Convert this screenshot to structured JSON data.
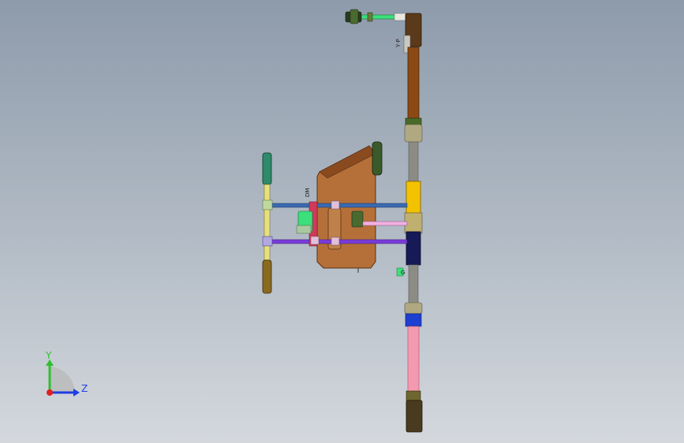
{
  "viewport": {
    "background_top": "#8e9bab",
    "background_bottom": "#d4d8dd"
  },
  "triad": {
    "y_label": "Y",
    "z_label": "Z",
    "y_color": "#2fbf2f",
    "z_color": "#1f3fe0",
    "x_color": "#e02020"
  },
  "part_labels": {
    "top_elbow": "Y·P",
    "small_tag": "DM",
    "valve_tag": "G"
  },
  "colors": {
    "brown_pipe": "#8b4a14",
    "brown_dark": "#5a3a1a",
    "gold": "#f2c200",
    "navy": "#161a56",
    "pink": "#f49ab0",
    "blue_collar": "#1e3fd0",
    "olive": "#6e6630",
    "green_pipe": "#3be07a",
    "teal_bar": "#2e8a6a",
    "tank": "#b5703a",
    "yellow_pipe": "#e8e07a",
    "purple_pipe": "#7a3cd8",
    "steel_blue_pipe": "#3a6ab0",
    "light_pink_pipe": "#f0b0e0",
    "gray_pipe": "#8c8c84"
  },
  "icons": [
    "coordinate-triad-icon"
  ]
}
